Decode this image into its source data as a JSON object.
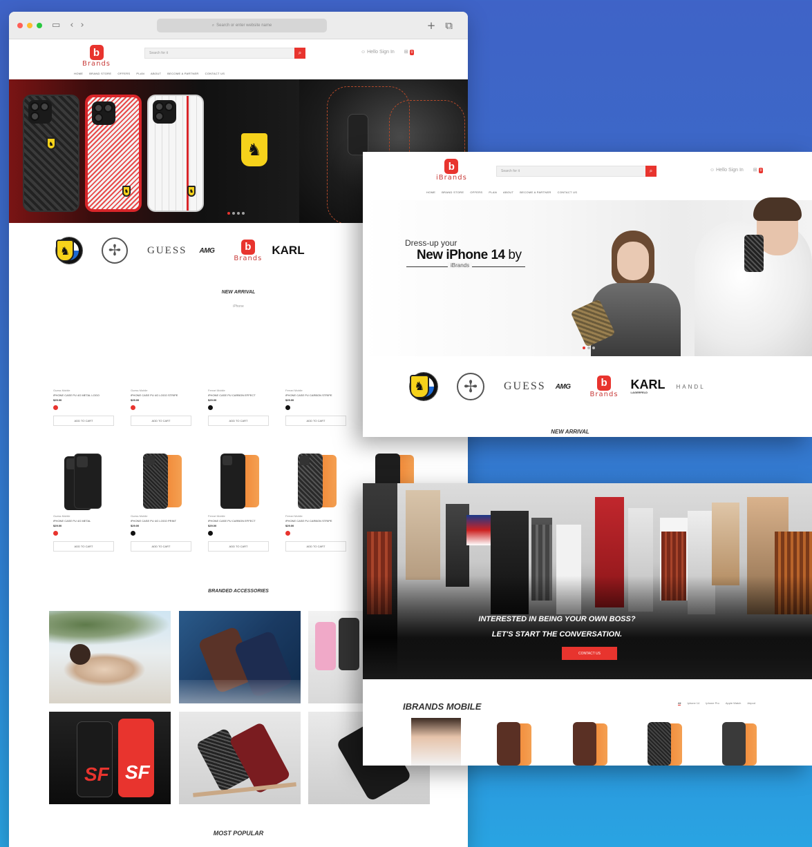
{
  "browser": {
    "url_placeholder": "Search or enter website name",
    "new_tab_icon": "plus-icon",
    "tabs_icon": "tabs-icon"
  },
  "site": {
    "logo_text": "Brands",
    "logo_text_alt": "iBrands",
    "search_placeholder": "Search for it",
    "account_label": "Hello Sign In",
    "cart_count": "0",
    "nav": [
      "HOME",
      "BRAND STORE",
      "OFFERS",
      "PLAN",
      "ABOUT",
      "BECOME A PARTNER",
      "CONTACT US"
    ],
    "accent": "#e8342e"
  },
  "brands": {
    "guess": "GUESS",
    "amg": "AMG",
    "karl": "KARL",
    "karl_sub": "LAGERFELD",
    "handl": "HANDL"
  },
  "sections": {
    "new_arrival": "NEW ARRIVAL",
    "new_arrival_sub": "iPhone",
    "branded_accessories": "BRANDED ACCESSORIES",
    "most_popular": "MOST POPULAR"
  },
  "products_row1": [
    {
      "brand": "Guess Mobile",
      "name": "iPHONE CASE PU 4G METAL LOGO",
      "price": "$29.00",
      "swatch": "#e8342e",
      "button": "ADD TO CART"
    },
    {
      "brand": "Guess Mobile",
      "name": "iPHONE CASE PU 4G LOGO STRIPE",
      "price": "$29.00",
      "swatch": "#e8342e",
      "button": "ADD TO CART"
    },
    {
      "brand": "Ferrari Mobile",
      "name": "iPHONE CASE PU CARBON EFFECT",
      "price": "$29.00",
      "swatch": "#111111",
      "button": "ADD TO CART"
    },
    {
      "brand": "Ferrari Mobile",
      "name": "iPHONE CASE PU CARBON STRIPE",
      "price": "$29.00",
      "swatch": "#111111",
      "button": "ADD TO CART"
    }
  ],
  "products_row2": [
    {
      "brand": "Guess Mobile",
      "name": "iPHONE CASE PU 4G METAL",
      "price": "$29.00",
      "swatch": "#e8342e",
      "button": "ADD TO CART"
    },
    {
      "brand": "Guess Mobile",
      "name": "iPHONE CASE PU 4G LOGO PRINT",
      "price": "$29.00",
      "swatch": "#111111",
      "button": "ADD TO CART"
    },
    {
      "brand": "Ferrari Mobile",
      "name": "iPHONE CASE PU CARBON EFFECT",
      "price": "$29.00",
      "swatch": "#111111",
      "button": "ADD TO CART"
    },
    {
      "brand": "Ferrari Mobile",
      "name": "iPHONE CASE PU CARBON STRIPE",
      "price": "$29.00",
      "swatch": "#e8342e",
      "button": "ADD TO CART"
    }
  ],
  "hero2": {
    "line1": "Dress-up your",
    "line2_bold": "New iPhone 14",
    "line2_rest": " by",
    "brand": "iBrands"
  },
  "store": {
    "cta_line1": "INTERESTED IN BEING YOUR OWN BOSS?",
    "cta_line2": "LET'S START THE CONVERSATION.",
    "cta_button": "CONTACT US"
  },
  "ibrands_mobile": {
    "title": "IBRANDS MOBILE",
    "tabs": [
      "All",
      "Iphone 14",
      "Iphone Pro",
      "Apple Watch",
      "Airpod"
    ]
  }
}
